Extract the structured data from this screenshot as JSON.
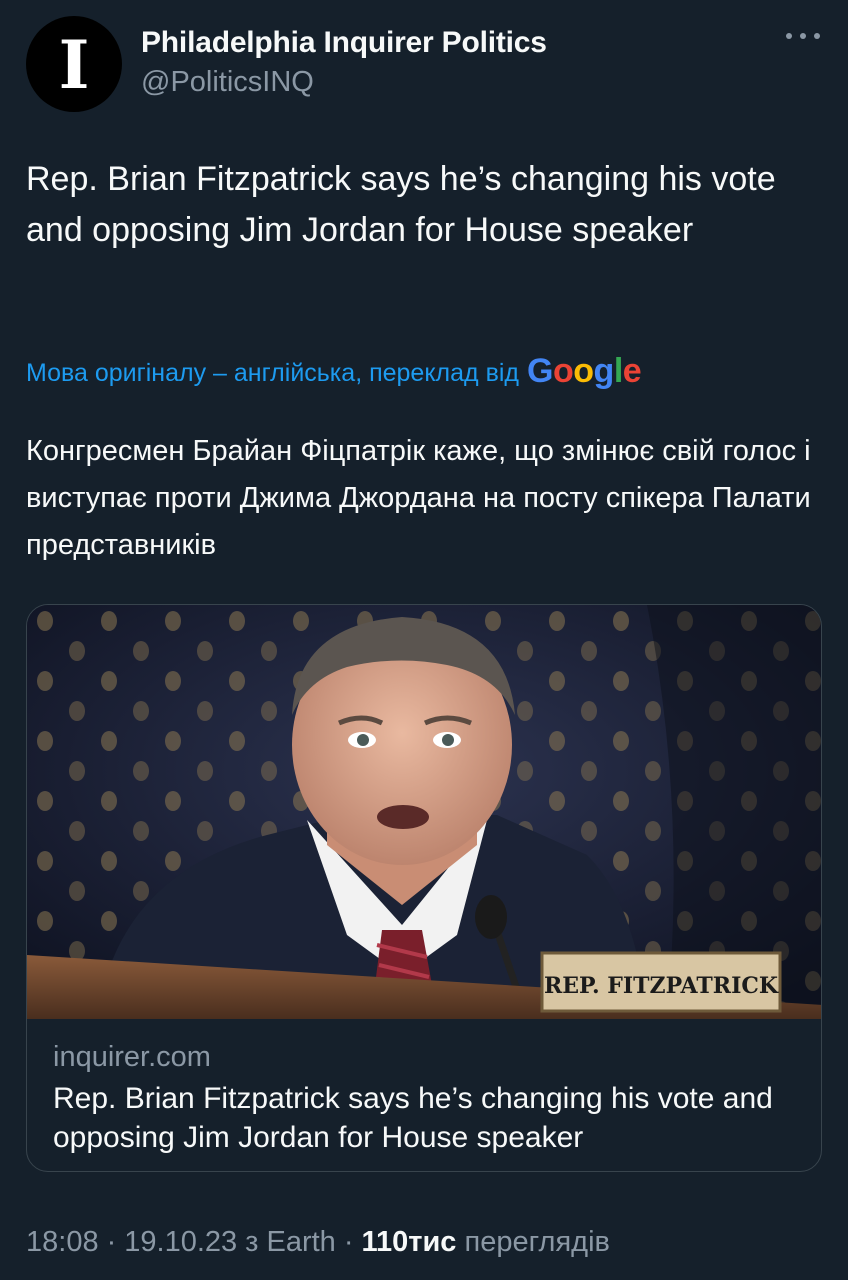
{
  "header": {
    "avatar_letter": "I",
    "display_name": "Philadelphia Inquirer Politics",
    "handle": "@PoliticsINQ",
    "more_icon": "more-dots-icon"
  },
  "tweet": {
    "text": "Rep. Brian Fitzpatrick says he’s changing his vote and opposing Jim Jordan for House speaker"
  },
  "translation": {
    "label": "Мова оригіналу – англійська, переклад від",
    "provider": "Google",
    "text": "Конгресмен Брайан Фіцпатрік каже, що змінює свій голос і виступає проти Джима Джордана на посту спікера Палати представників"
  },
  "card": {
    "image_nameplate": "REP. FITZPATRICK",
    "domain": "inquirer.com",
    "title": "Rep. Brian Fitzpatrick says he’s changing his vote and opposing Jim Jordan for House speaker"
  },
  "meta": {
    "time": "18:08",
    "sep1": "·",
    "date": "19.10.23",
    "source": "з Earth",
    "sep2": "·",
    "views_count": "110тис",
    "views_label": "переглядів"
  },
  "colors": {
    "background": "#15202b",
    "text": "#f7f9f9",
    "secondary": "#8b98a5",
    "link": "#1d9bf0",
    "border": "#38444d"
  }
}
